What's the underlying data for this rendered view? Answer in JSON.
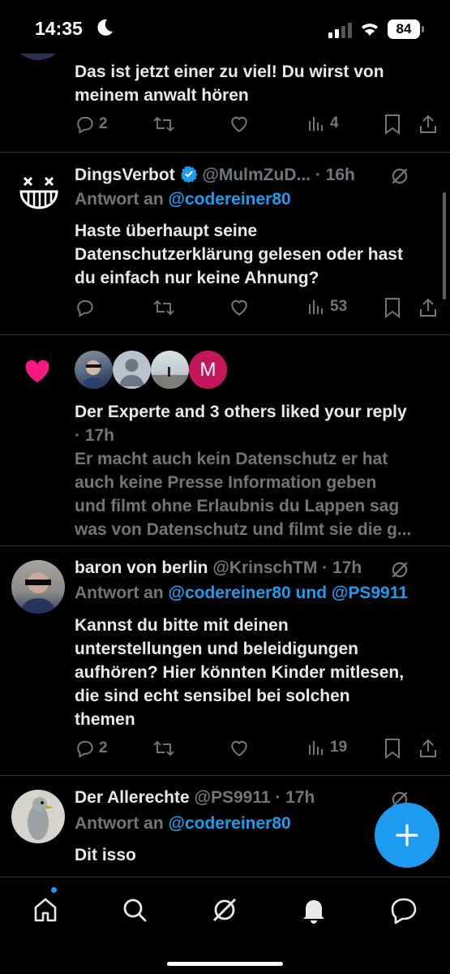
{
  "status_bar": {
    "time": "14:35",
    "battery": "84"
  },
  "tweets": [
    {
      "body_lines": [
        "Das ist jetzt einer zu viel! Du wirst von",
        "meinem anwalt hören"
      ],
      "replies": "2",
      "views": "4"
    },
    {
      "name": "DingsVerbot",
      "handle": "@MulmZuD...",
      "time": "· 16h",
      "reply_prefix": "Antwort an",
      "reply_user": "@codereiner80",
      "body_lines": [
        "Haste überhaupt seine",
        "Datenschutzerklärung gelesen oder hast",
        "du einfach nur keine Ahnung?"
      ],
      "replies": "",
      "views": "53"
    },
    {
      "name": "baron von berlin",
      "handle": "@KrinschTM",
      "time": "· 17h",
      "reply_prefix": "Antwort an",
      "reply_user": "@codereiner80 und @PS9911",
      "body_lines": [
        "Kannst du bitte mit deinen",
        "unterstellungen und beleidigungen",
        "aufhören? Hier könnten Kinder mitlesen,",
        "die sind echt sensibel bei solchen",
        "themen"
      ],
      "replies": "2",
      "views": "19"
    },
    {
      "name": "Der Allerechte",
      "handle": "@PS9911",
      "time": "· 17h",
      "reply_prefix": "Antwort an",
      "reply_user": "@codereiner80",
      "body_lines": [
        "Dit isso"
      ]
    }
  ],
  "notification": {
    "liker_initial": "M",
    "title": "Der Experte and 3 others liked your reply",
    "time": "· 17h",
    "preview_lines": [
      "Er macht auch kein Datenschutz er hat",
      "auch keine Presse Information geben",
      "und filmt ohne Erlaubnis du Lappen sag",
      "was von Datenschutz und filmt sie die g..."
    ]
  },
  "icons": {
    "reply": "reply-bubble-icon",
    "retweet": "retweet-icon",
    "like": "heart-icon",
    "views": "views-bars-icon",
    "bookmark": "bookmark-icon",
    "share": "share-icon",
    "grok": "grok-icon",
    "compose": "plus-icon"
  },
  "colors": {
    "accent": "#1d9bf0",
    "like": "#f91880",
    "text": "#e7e9ea",
    "muted": "#71767b",
    "background": "#000000"
  }
}
